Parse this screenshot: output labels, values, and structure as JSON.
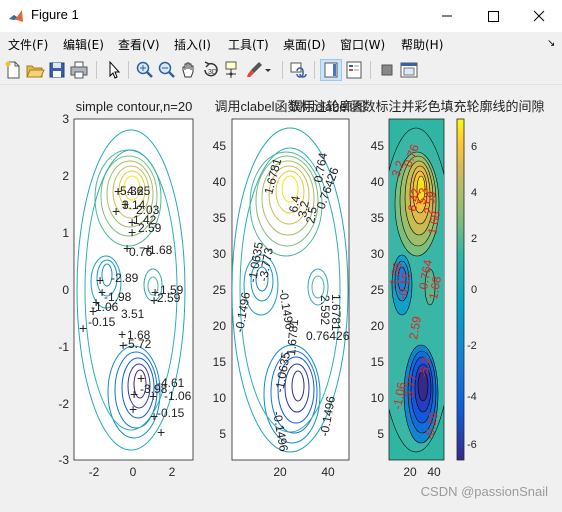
{
  "window": {
    "title": "Figure 1"
  },
  "menu": [
    "文件(F)",
    "编辑(E)",
    "查看(V)",
    "插入(I)",
    "工具(T)",
    "桌面(D)",
    "窗口(W)",
    "帮助(H)"
  ],
  "menu_overflow": "↘",
  "toolbar_icons": [
    "new-figure-icon",
    "open-file-icon",
    "save-icon",
    "print-icon",
    "pointer-icon",
    "zoom-in-icon",
    "zoom-out-icon",
    "pan-icon",
    "rotate-icon",
    "data-cursor-icon",
    "brush-icon",
    "link-plot-icon",
    "insert-colorbar-icon",
    "insert-legend-icon",
    "hide-plot-tools-icon",
    "show-plot-tools-icon"
  ],
  "titles": {
    "left": "simple contour,n=20",
    "middle": "调用clabel函数标注轮廓图",
    "right": "调用clabel函数标注并彩色填充轮廓线的间隙"
  },
  "axes1": {
    "yticks": [
      "3",
      "2",
      "1",
      "0",
      "-1",
      "-2",
      "-3"
    ],
    "xticks": [
      "-2",
      "0",
      "2"
    ],
    "labels": [
      "5.36",
      "4.25",
      "3.14",
      "2.03",
      "1.42",
      "2.59",
      "0.76",
      "1.68",
      "-2.89",
      "-1.98",
      "-0.15",
      "-1.06",
      "3.51",
      "1.59",
      "2.59",
      "1.68",
      "-5.72",
      "-4.61",
      "-3.98",
      "-1.06",
      "-0.15"
    ]
  },
  "axes2": {
    "yticks": [
      "45",
      "40",
      "35",
      "30",
      "25",
      "20",
      "15",
      "10",
      "5"
    ],
    "xticks": [
      "20",
      "40"
    ],
    "labels": [
      "1.6781",
      "6.4",
      "3.2",
      "2.5",
      "0.764",
      "0.76426",
      "-1.0635",
      "-0.1496",
      "-0.1496",
      "1.6781",
      "0.76426",
      "-1.0635",
      "-3.773",
      "-0.1496",
      "-0.1496",
      "2.592",
      "1.6781"
    ]
  },
  "axes3": {
    "yticks": [
      "45",
      "40",
      "35",
      "30",
      "25",
      "20",
      "15",
      "10",
      "5"
    ],
    "xticks": [
      "20",
      "40"
    ],
    "colorbar_ticks": [
      "6",
      "4",
      "2",
      "0",
      "-2",
      "-4",
      "-6"
    ]
  },
  "watermark": "CSDN @passionSnail"
}
